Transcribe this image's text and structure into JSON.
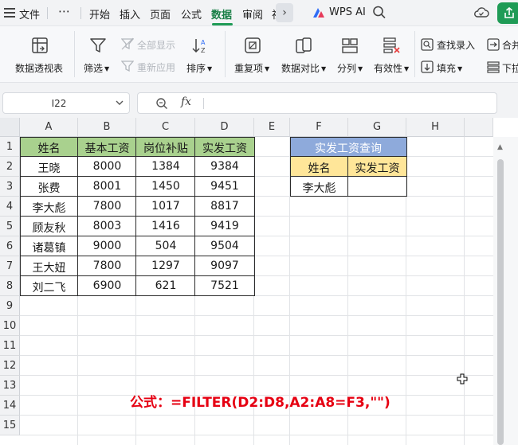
{
  "menu": {
    "file": "文件",
    "more": "⋯",
    "tabs": [
      "开始",
      "插入",
      "页面",
      "公式",
      "数据",
      "审阅",
      "视"
    ],
    "active_tab_index": 4,
    "wps_ai": "WPS AI"
  },
  "ribbon": {
    "pivot_table": "数据透视表",
    "filter": "筛选",
    "show_all": "全部显示",
    "reapply": "重新应用",
    "sort": "排序",
    "duplicates": "重复项",
    "compare": "数据对比",
    "split": "分列",
    "validation": "有效性",
    "lookup_entry": "查找录入",
    "fill": "填充",
    "merge": "合并",
    "dropdown": "下拉"
  },
  "formula_bar": {
    "name_box": "I22",
    "fx": "fx",
    "formula": ""
  },
  "sheet": {
    "columns": [
      "A",
      "B",
      "C",
      "D",
      "E",
      "F",
      "G",
      "H"
    ],
    "rows": [
      "1",
      "2",
      "3",
      "4",
      "5",
      "6",
      "7",
      "8",
      "9",
      "10",
      "11",
      "12",
      "13",
      "14",
      "15"
    ],
    "table": {
      "headers": [
        "姓名",
        "基本工资",
        "岗位补贴",
        "实发工资"
      ],
      "rows": [
        [
          "王晓",
          "8000",
          "1384",
          "9384"
        ],
        [
          "张费",
          "8001",
          "1450",
          "9451"
        ],
        [
          "李大彪",
          "7800",
          "1017",
          "8817"
        ],
        [
          "顾友秋",
          "8003",
          "1416",
          "9419"
        ],
        [
          "诸葛镇",
          "9000",
          "504",
          "9504"
        ],
        [
          "王大妞",
          "7800",
          "1297",
          "9097"
        ],
        [
          "刘二飞",
          "6900",
          "621",
          "7521"
        ]
      ]
    },
    "lookup": {
      "title": "实发工资查询",
      "header_name": "姓名",
      "header_salary": "实发工资",
      "query_name": "李大彪",
      "result": ""
    },
    "formula_note": "公式：=FILTER(D2:D8,A2:A8=F3,\"\")"
  },
  "colors": {
    "accent_green": "#1f9b56",
    "header_green": "#a9d18e",
    "lookup_title_blue": "#8eaadb",
    "lookup_header_yellow": "#ffe699",
    "formula_red": "#e60012"
  }
}
